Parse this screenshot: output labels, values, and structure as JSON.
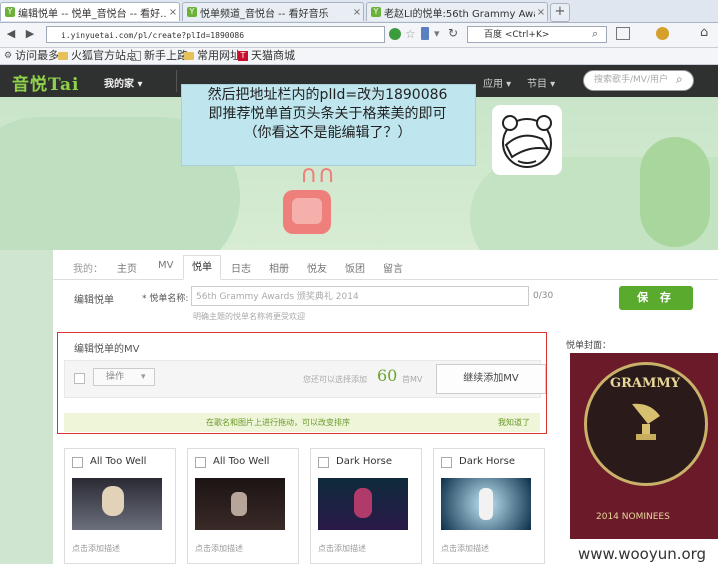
{
  "browser": {
    "tabs": [
      {
        "label": "编辑悦单 -- 悦单_音悦台 -- 看好..."
      },
      {
        "label": "悦单频道_音悦台 -- 看好音乐"
      },
      {
        "label": "老赵LI的悦单:56th Grammy Awards ..."
      }
    ],
    "new_tab": "+",
    "url": "i.yinyuetai.com/pl/create?plId=1890086",
    "search_engine": "百度 <Ctrl+K>",
    "bookmarks": [
      "访问最多",
      "火狐官方站点",
      "新手上路",
      "常用网址",
      "天猫商城"
    ]
  },
  "site": {
    "logo": "音悦Tai",
    "nav_mine": "我的家",
    "nav_right": [
      "应用",
      "节目"
    ],
    "search_placeholder": "搜索歌手/MV/用户"
  },
  "callout": {
    "line1": "然后把地址栏内的plId=改为1890086",
    "line2": "即推荐悦单首页头条关于格莱美的即可",
    "line3": "（你看这不是能编辑了？）"
  },
  "profile_tabs": {
    "prefix": "我的：",
    "items": [
      "主页",
      "MV",
      "悦单",
      "日志",
      "相册",
      "悦友",
      "饭团",
      "留言"
    ],
    "active": "悦单"
  },
  "form": {
    "section_title": "编辑悦单",
    "name_label": "* 悦单名称:",
    "name_value": "56th Grammy Awards 颁奖典礼 2014",
    "counter": "0/30",
    "hint": "明确主题的悦单名称将更受欢迎",
    "save_label": "保 存"
  },
  "mv_editor": {
    "title": "编辑悦单的MV",
    "op_label": "操作",
    "remain_prefix": "您还可以选择添加",
    "remain_count": "60",
    "remain_suffix": "首MV",
    "continue_label": "继续添加MV",
    "drag_tip": "在歌名和图片上进行拖动，可以改变排序",
    "got_it": "我知道了"
  },
  "mv_items": [
    {
      "title": "All Too Well",
      "desc": "点击添加描述"
    },
    {
      "title": "All Too Well",
      "desc": "点击添加描述"
    },
    {
      "title": "Dark Horse",
      "desc": "点击添加描述"
    },
    {
      "title": "Dark Horse",
      "desc": "点击添加描述"
    }
  ],
  "cover": {
    "label": "悦单封面：",
    "word": "GRAMMY",
    "year_text": "2014 NOMINEES"
  },
  "watermark": "www.wooyun.org"
}
